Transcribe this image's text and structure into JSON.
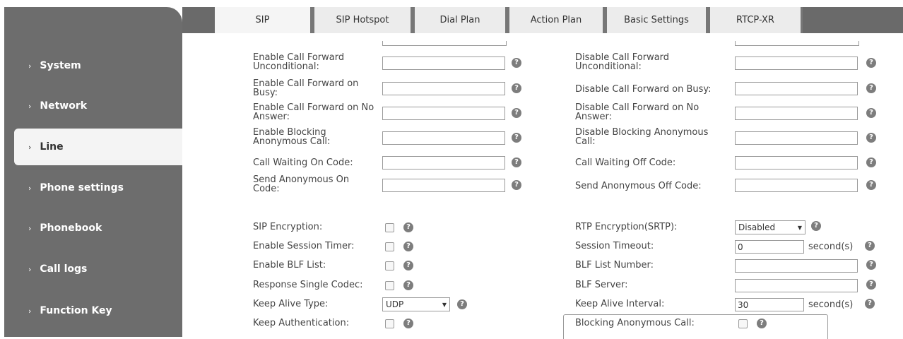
{
  "sidebar": {
    "items": [
      {
        "label": "System"
      },
      {
        "label": "Network"
      },
      {
        "label": "Line"
      },
      {
        "label": "Phone settings"
      },
      {
        "label": "Phonebook"
      },
      {
        "label": "Call logs"
      },
      {
        "label": "Function Key"
      }
    ],
    "chevron": "›"
  },
  "tabs": [
    {
      "label": "SIP"
    },
    {
      "label": "SIP Hotspot"
    },
    {
      "label": "Dial Plan"
    },
    {
      "label": "Action Plan"
    },
    {
      "label": "Basic Settings"
    },
    {
      "label": "RTCP-XR"
    }
  ],
  "help_glyph": "?",
  "left_codes": [
    {
      "label": "Enable Call Forward Unconditional:",
      "value": ""
    },
    {
      "label": "Enable Call Forward on Busy:",
      "value": ""
    },
    {
      "label": "Enable Call Forward on No Answer:",
      "value": ""
    },
    {
      "label": "Enable Blocking Anonymous Call:",
      "value": ""
    },
    {
      "label": "Call Waiting On Code:",
      "value": ""
    },
    {
      "label": "Send Anonymous On Code:",
      "value": ""
    }
  ],
  "right_codes": [
    {
      "label": "Disable Call Forward Unconditional:",
      "value": ""
    },
    {
      "label": "Disable Call Forward on Busy:",
      "value": ""
    },
    {
      "label": "Disable Call Forward on No Answer:",
      "value": ""
    },
    {
      "label": "Disable Blocking Anonymous Call:",
      "value": ""
    },
    {
      "label": "Call Waiting Off Code:",
      "value": ""
    },
    {
      "label": "Send Anonymous Off Code:",
      "value": ""
    }
  ],
  "left_settings": [
    {
      "label": "SIP Encryption:"
    },
    {
      "label": "Enable Session Timer:"
    },
    {
      "label": "Enable BLF List:"
    },
    {
      "label": "Response Single Codec:"
    },
    {
      "label": "Keep Alive Type:",
      "select": "UDP"
    },
    {
      "label": "Keep Authentication:"
    }
  ],
  "right_settings": [
    {
      "label": "RTP Encryption(SRTP):",
      "select": "Disabled"
    },
    {
      "label": "Session Timeout:",
      "value": "0",
      "unit": "second(s)"
    },
    {
      "label": "BLF List Number:",
      "value": ""
    },
    {
      "label": "BLF Server:",
      "value": ""
    },
    {
      "label": "Keep Alive Interval:",
      "value": "30",
      "unit": "second(s)"
    },
    {
      "label": "Blocking Anonymous Call:"
    }
  ],
  "select_arrow": "▼"
}
